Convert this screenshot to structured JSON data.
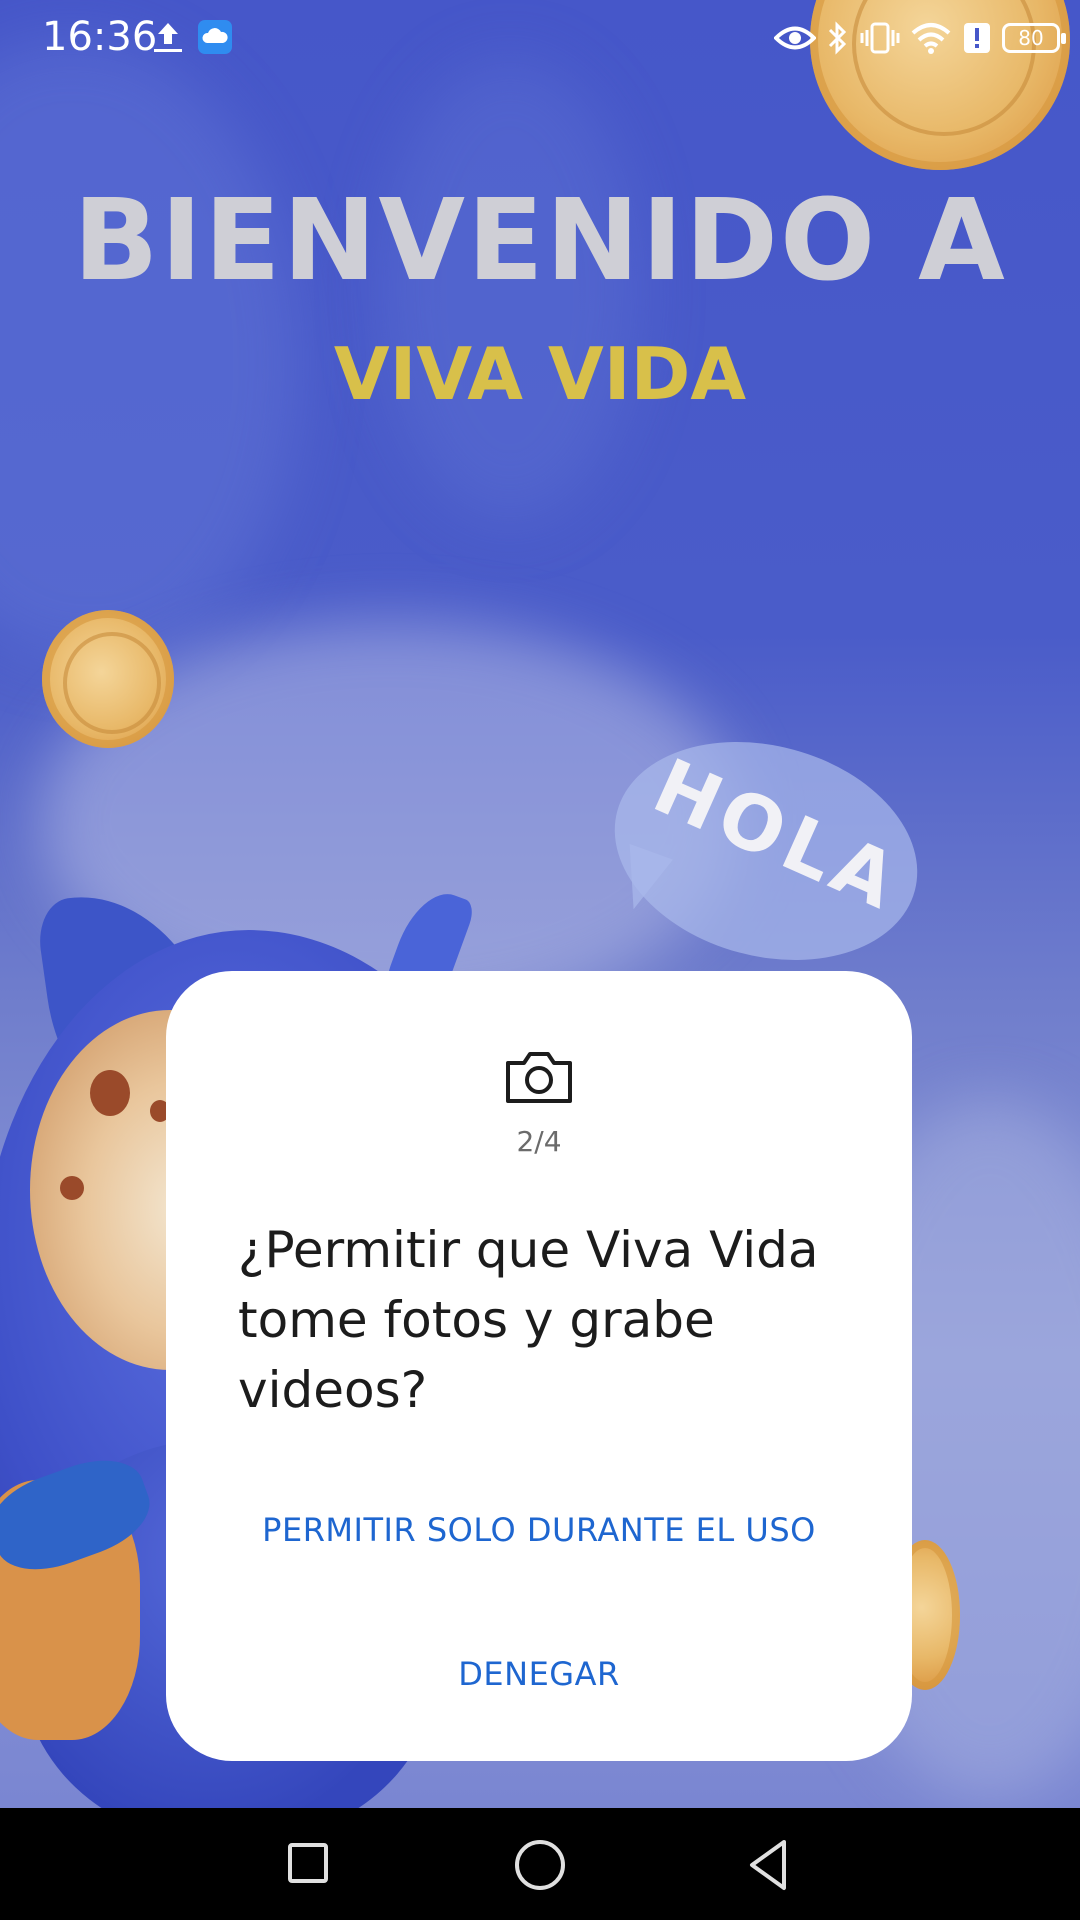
{
  "status_bar": {
    "time": "16:36",
    "battery_level": "80",
    "icons": [
      "upload-icon",
      "cloud-icon",
      "eye-icon",
      "bluetooth-icon",
      "vibrate-icon",
      "wifi-icon",
      "alert-icon",
      "battery-icon"
    ]
  },
  "background": {
    "welcome_line": "BIENVENIDO A",
    "app_name": "VIVA VIDA",
    "bubble_text": "HOLA",
    "colors": {
      "background": "#4657c9",
      "welcome": "#cfcfd6",
      "app_name": "#d8c04a"
    }
  },
  "permission_dialog": {
    "icon": "camera-icon",
    "step_counter": "2/4",
    "question": "¿Permitir que Viva Vida tome fotos y grabe videos?",
    "allow_label": "PERMITIR SOLO DURANTE EL USO",
    "deny_label": "DENEGAR",
    "button_color": "#1e66d0"
  },
  "nav_bar": {
    "buttons": [
      "recents-button",
      "home-button",
      "back-button"
    ]
  }
}
